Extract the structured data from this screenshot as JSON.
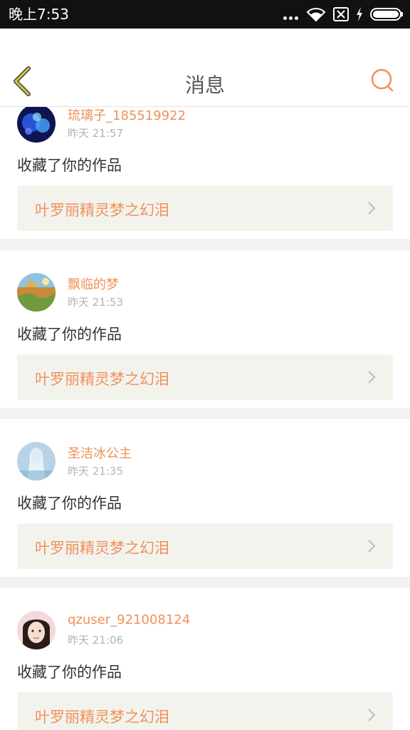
{
  "status_bar": {
    "time": "晚上7:53",
    "icons": [
      "more-dots-icon",
      "wifi-icon",
      "no-sim-icon",
      "charging-icon",
      "battery-icon"
    ]
  },
  "header": {
    "title": "消息",
    "back_icon": "chevron-left-icon",
    "search_icon": "search-icon"
  },
  "colors": {
    "accent": "#f0915a",
    "back_icon": "#c9b836",
    "status_bar_bg": "#111111",
    "card_link_bg": "#f3f3ee",
    "divider": "#f2f2f2"
  },
  "messages": [
    {
      "username": "琉璃子_185519922",
      "time": "昨天 21:57",
      "action": "收藏了你的作品",
      "work_title": "叶罗丽精灵梦之幻泪",
      "avatar": "avatar-blue-bubbles"
    },
    {
      "username": "飘临的梦",
      "time": "昨天 21:53",
      "action": "收藏了你的作品",
      "work_title": "叶罗丽精灵梦之幻泪",
      "avatar": "avatar-landscape"
    },
    {
      "username": "圣洁冰公主",
      "time": "昨天 21:35",
      "action": "收藏了你的作品",
      "work_title": "叶罗丽精灵梦之幻泪",
      "avatar": "avatar-ice-princess"
    },
    {
      "username": "qzuser_921008124",
      "time": "昨天 21:06",
      "action": "收藏了你的作品",
      "work_title": "叶罗丽精灵梦之幻泪",
      "avatar": "avatar-girl-photo"
    }
  ]
}
